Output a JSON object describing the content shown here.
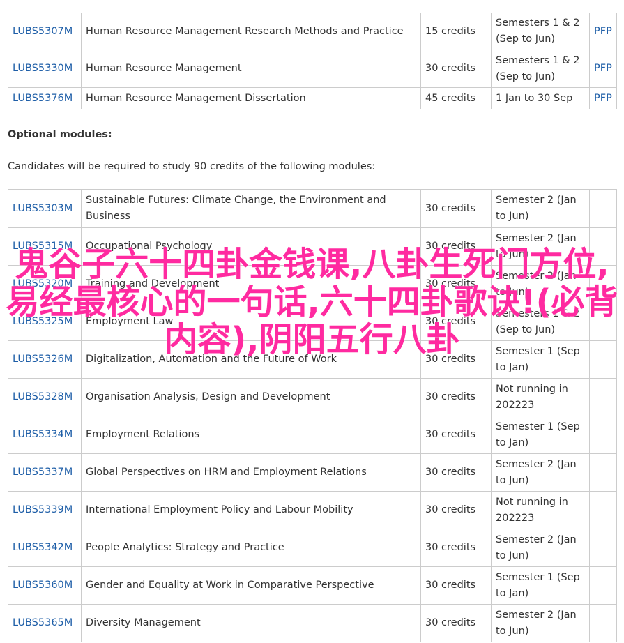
{
  "core_modules": [
    {
      "code": "LUBS5307M",
      "title": "Human Resource Management Research Methods and Practice",
      "credits": "15 credits",
      "semester": "Semesters 1 & 2 (Sep to Jun)",
      "pfp": "PFP"
    },
    {
      "code": "LUBS5330M",
      "title": "Human Resource Management",
      "credits": "30 credits",
      "semester": "Semesters 1 & 2 (Sep to Jun)",
      "pfp": "PFP"
    },
    {
      "code": "LUBS5376M",
      "title": "Human Resource Management Dissertation",
      "credits": "45 credits",
      "semester": "1 Jan to 30 Sep",
      "pfp": "PFP"
    }
  ],
  "optional": {
    "heading": "Optional modules:",
    "intro": "Candidates will be required to study 90 credits of the following modules:",
    "modules": [
      {
        "code": "LUBS5303M",
        "title": "Sustainable Futures: Climate Change, the Environment and Business",
        "credits": "30 credits",
        "semester": "Semester 2 (Jan to Jun)"
      },
      {
        "code": "LUBS5315M",
        "title": "Occupational Psychology",
        "credits": "30 credits",
        "semester": "Semester 2 (Jan to Jun)"
      },
      {
        "code": "LUBS5320M",
        "title": "Training and Development",
        "credits": "30 credits",
        "semester": "Semester 2 (Jan to Jun)"
      },
      {
        "code": "LUBS5325M",
        "title": "Employment Law",
        "credits": "30 credits",
        "semester": "Semesters 1 & 2 (Sep to Jun)"
      },
      {
        "code": "LUBS5326M",
        "title": "Digitalization, Automation and the Future of Work",
        "credits": "30 credits",
        "semester": "Semester 1 (Sep to Jan)"
      },
      {
        "code": "LUBS5328M",
        "title": "Organisation Analysis, Design and Development",
        "credits": "30 credits",
        "semester": "Not running in 202223"
      },
      {
        "code": "LUBS5334M",
        "title": "Employment Relations",
        "credits": "30 credits",
        "semester": "Semester 1 (Sep to Jan)"
      },
      {
        "code": "LUBS5337M",
        "title": "Global Perspectives on HRM and Employment Relations",
        "credits": "30 credits",
        "semester": "Semester 2 (Jan to Jun)"
      },
      {
        "code": "LUBS5339M",
        "title": "International Employment Policy and Labour Mobility",
        "credits": "30 credits",
        "semester": "Not running in 202223"
      },
      {
        "code": "LUBS5342M",
        "title": "People Analytics: Strategy and Practice",
        "credits": "30 credits",
        "semester": "Semester 2 (Jan to Jun)"
      },
      {
        "code": "LUBS5360M",
        "title": "Gender and Equality at Work in Comparative Perspective",
        "credits": "30 credits",
        "semester": "Semester 1 (Sep to Jan)"
      },
      {
        "code": "LUBS5365M",
        "title": "Diversity Management",
        "credits": "30 credits",
        "semester": "Semester 2 (Jan to Jun)"
      }
    ]
  },
  "overlay_text": "鬼谷子六十四卦金钱课,八卦生死门方位,易经最核心的一句话,六十四卦歌诀!(必背内容),阴阳五行八卦",
  "colors": {
    "link": "#1f5fa8",
    "border": "#cccccc",
    "overlay": "#ff2aa0"
  }
}
